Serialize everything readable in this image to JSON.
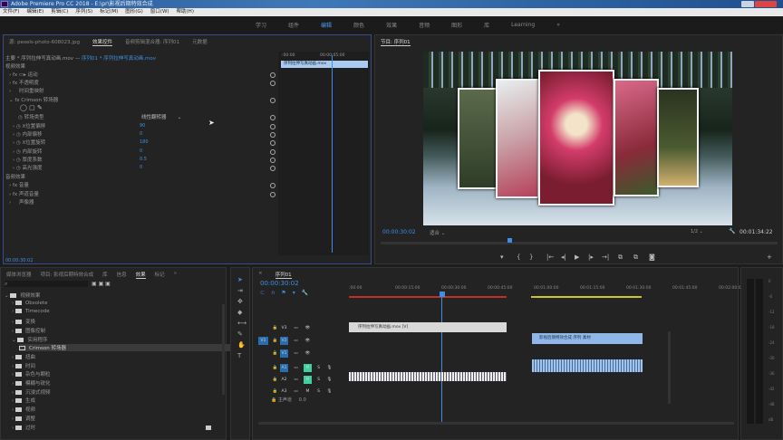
{
  "title": "Adobe Premiere Pro CC 2018 - E:\\pr\\影视后期特效合成",
  "menu": [
    "文件(F)",
    "编辑(E)",
    "剪辑(C)",
    "序列(S)",
    "标记(M)",
    "图形(G)",
    "窗口(W)",
    "帮助(H)"
  ],
  "workspaces": [
    {
      "label": "学习"
    },
    {
      "label": "组件"
    },
    {
      "label": "编辑",
      "active": true
    },
    {
      "label": "颜色"
    },
    {
      "label": "效果"
    },
    {
      "label": "音频"
    },
    {
      "label": "图形"
    },
    {
      "label": "库"
    },
    {
      "label": "Learning"
    },
    {
      "label": "»"
    }
  ],
  "effect_controls": {
    "tabs": [
      "源: pexels-photo-608023.jpg",
      "效果控件",
      "音频剪辑混合器: 序列01",
      "元数据"
    ],
    "source": "主要 * 序列拉伸写真动画.mov",
    "link": "序列01 * 序列拉伸写真动画.mov",
    "mini_timecodes": [
      ":00:00",
      "00:00:05:00"
    ],
    "mini_clip": "序列拉伸写真动画.mov",
    "video_effects_label": "视频效果",
    "rows": [
      "运动",
      "不透明度",
      "时间重映射",
      "Crimson 转场器",
      "转场类型",
      "X位置偏移",
      "内部偏移",
      "X位置旋转",
      "内部旋转",
      "厚度系数",
      "高光强度"
    ],
    "dropdown": "线性翻转器",
    "values": [
      "90",
      "0",
      "180",
      "0",
      "0.5",
      "0"
    ],
    "audio_effects_label": "音频效果",
    "audio_rows": [
      "音量",
      "声道音量",
      "声像器"
    ],
    "footer_time": "00:00:30:02"
  },
  "program": {
    "title": "节目: 序列01",
    "timecode": "00:00:30:02",
    "fit": "适合",
    "quality": "1/2",
    "duration": "00:01:34:22",
    "playhead_fraction": 0.32
  },
  "effects_panel": {
    "tabs": [
      "媒体浏览器",
      "项目: 影视后期特效合成",
      "库",
      "信息",
      "效果",
      "标记",
      "»"
    ],
    "items": [
      {
        "label": "视频效果",
        "level": 0
      },
      {
        "label": "Obsolete",
        "level": 1
      },
      {
        "label": "Timecode",
        "level": 1
      },
      {
        "label": "变换",
        "level": 1
      },
      {
        "label": "图像控制",
        "level": 1
      },
      {
        "label": "实用程序",
        "level": 1
      },
      {
        "label": "Crimson 转场器",
        "level": 2,
        "selected": true
      },
      {
        "label": "扭曲",
        "level": 1
      },
      {
        "label": "时间",
        "level": 1
      },
      {
        "label": "杂色与颗粒",
        "level": 1
      },
      {
        "label": "模糊与锐化",
        "level": 1
      },
      {
        "label": "沉浸式视频",
        "level": 1
      },
      {
        "label": "生成",
        "level": 1
      },
      {
        "label": "视频",
        "level": 1
      },
      {
        "label": "调整",
        "level": 1
      },
      {
        "label": "过时",
        "level": 1
      }
    ]
  },
  "timeline": {
    "title": "序列01",
    "timecode": "00:00:30:02",
    "ruler": [
      ":00:00",
      "00:00:15:00",
      "00:00:30:00",
      "00:00:45:00",
      "00:01:00:00",
      "00:01:15:00",
      "00:01:30:00",
      "00:01:45:00",
      "00:02:00:00"
    ],
    "tracks": [
      "V3",
      "V2",
      "V1",
      "A1",
      "A2",
      "A3"
    ],
    "master": "主声道",
    "master_val": "0.0",
    "clip_v3": "序列拉伸写真动画.mov [V]",
    "clip_v2": "影视后期特效合成 序列 素材",
    "meter_ticks": [
      "0",
      "-6",
      "-12",
      "-18",
      "-24",
      "-30",
      "-36",
      "-42",
      "-48",
      "dB"
    ]
  }
}
